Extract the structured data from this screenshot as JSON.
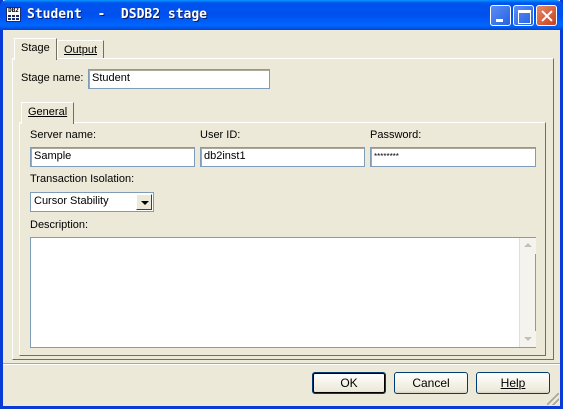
{
  "window": {
    "title": "Student  -  DSDB2 stage",
    "icon_text": "DB2"
  },
  "tabs": [
    {
      "label": "Stage",
      "active": true
    },
    {
      "label": "Output",
      "active": false
    }
  ],
  "stage": {
    "name_label": "Stage name:",
    "name_value": "Student"
  },
  "inner_tabs": [
    {
      "label": "General",
      "active": true
    }
  ],
  "general": {
    "server_label": "Server name:",
    "server_value": "Sample",
    "user_label": "User ID:",
    "user_value": "db2inst1",
    "password_label": "Password:",
    "password_value": "********",
    "isolation_label": "Transaction Isolation:",
    "isolation_value": "Cursor Stability",
    "description_label": "Description:",
    "description_value": ""
  },
  "buttons": {
    "ok": "OK",
    "cancel": "Cancel",
    "help": "Help"
  }
}
